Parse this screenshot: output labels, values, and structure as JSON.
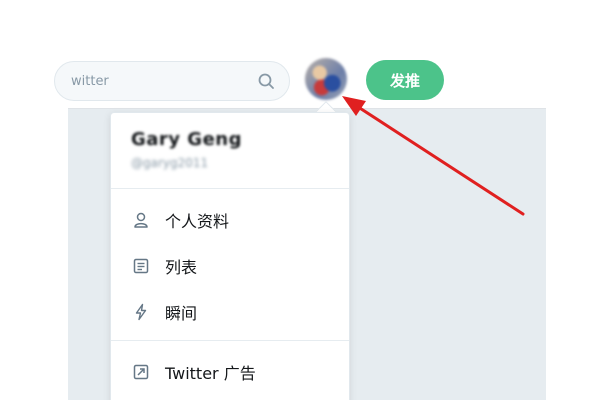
{
  "search": {
    "placeholder": "witter"
  },
  "header": {
    "tweet_label": "发推"
  },
  "account": {
    "name": "Gary Geng",
    "handle": "@garyg2011"
  },
  "menu": {
    "items": [
      {
        "label": "个人资料",
        "icon": "person-icon"
      },
      {
        "label": "列表",
        "icon": "list-icon"
      },
      {
        "label": "瞬间",
        "icon": "lightning-icon"
      }
    ],
    "secondary": [
      {
        "label": "Twitter 广告",
        "icon": "external-link-icon"
      }
    ]
  },
  "colors": {
    "tweet_button": "#4cc38a",
    "annotation_arrow": "#e02020",
    "content_bg": "#e6ecf0"
  }
}
